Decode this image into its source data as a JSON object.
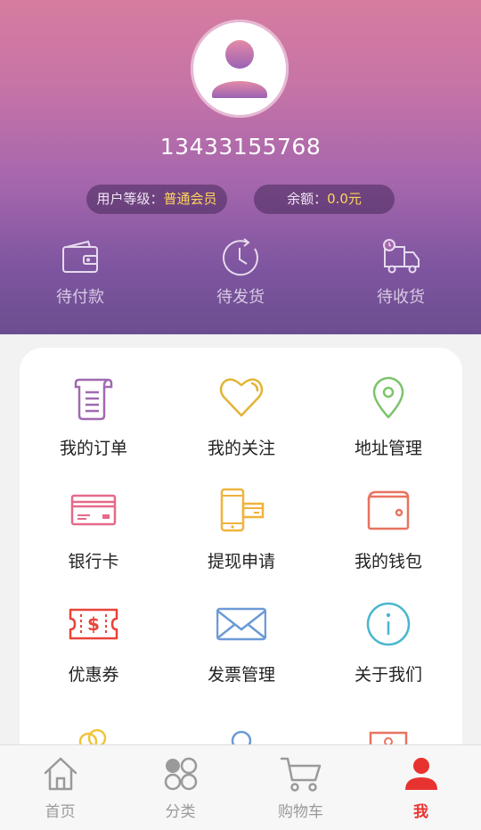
{
  "user": {
    "phone": "13433155768",
    "level_label": "用户等级：",
    "level_value": "普通会员",
    "balance_label": "余额：",
    "balance_value": "0.0元"
  },
  "orders": [
    {
      "label": "待付款",
      "icon": "wallet-icon"
    },
    {
      "label": "待发货",
      "icon": "clock-icon"
    },
    {
      "label": "待收货",
      "icon": "truck-icon"
    }
  ],
  "menu": [
    {
      "label": "我的订单",
      "icon": "order-list-icon",
      "color": "#a06ab0"
    },
    {
      "label": "我的关注",
      "icon": "heart-icon",
      "color": "#e2b436"
    },
    {
      "label": "地址管理",
      "icon": "location-pin-icon",
      "color": "#7cc46b"
    },
    {
      "label": "银行卡",
      "icon": "bank-card-icon",
      "color": "#e56a8a"
    },
    {
      "label": "提现申请",
      "icon": "phone-withdraw-icon",
      "color": "#f0b33c"
    },
    {
      "label": "我的钱包",
      "icon": "wallet-icon",
      "color": "#e8735f"
    },
    {
      "label": "优惠券",
      "icon": "coupon-icon",
      "color": "#e8443a"
    },
    {
      "label": "发票管理",
      "icon": "envelope-icon",
      "color": "#6b9ad6"
    },
    {
      "label": "关于我们",
      "icon": "info-icon",
      "color": "#4ab7cf"
    }
  ],
  "tabs": [
    {
      "label": "首页",
      "icon": "home-icon"
    },
    {
      "label": "分类",
      "icon": "category-icon"
    },
    {
      "label": "购物车",
      "icon": "cart-icon"
    },
    {
      "label": "我",
      "icon": "user-icon"
    }
  ],
  "colors": {
    "accent": "#e8322f",
    "highlight": "#ffd45c"
  }
}
